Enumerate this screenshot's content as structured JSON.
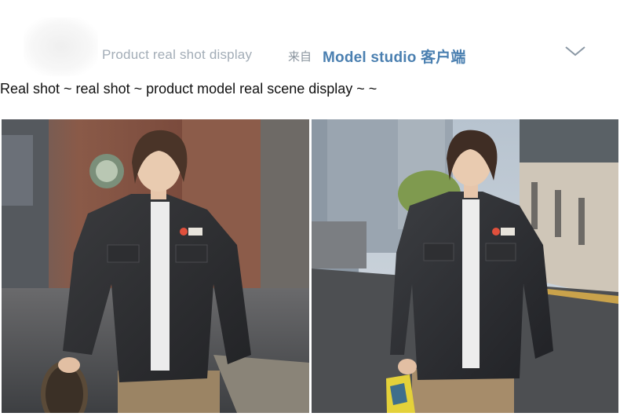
{
  "header": {
    "title": "Product real shot display",
    "from_label": "来自",
    "studio_name": "Model studio 客户端",
    "expand_icon": "chevron-down-icon"
  },
  "subtitle": "Real shot ~ real shot ~ product model real scene display ~ ~",
  "photos": [
    {
      "scene": "brick street, model with skateboard, black denim jacket, khaki cargo pants"
    },
    {
      "scene": "city street with buildings, model with yellow bag, black denim jacket, khaki cargo pants"
    }
  ]
}
